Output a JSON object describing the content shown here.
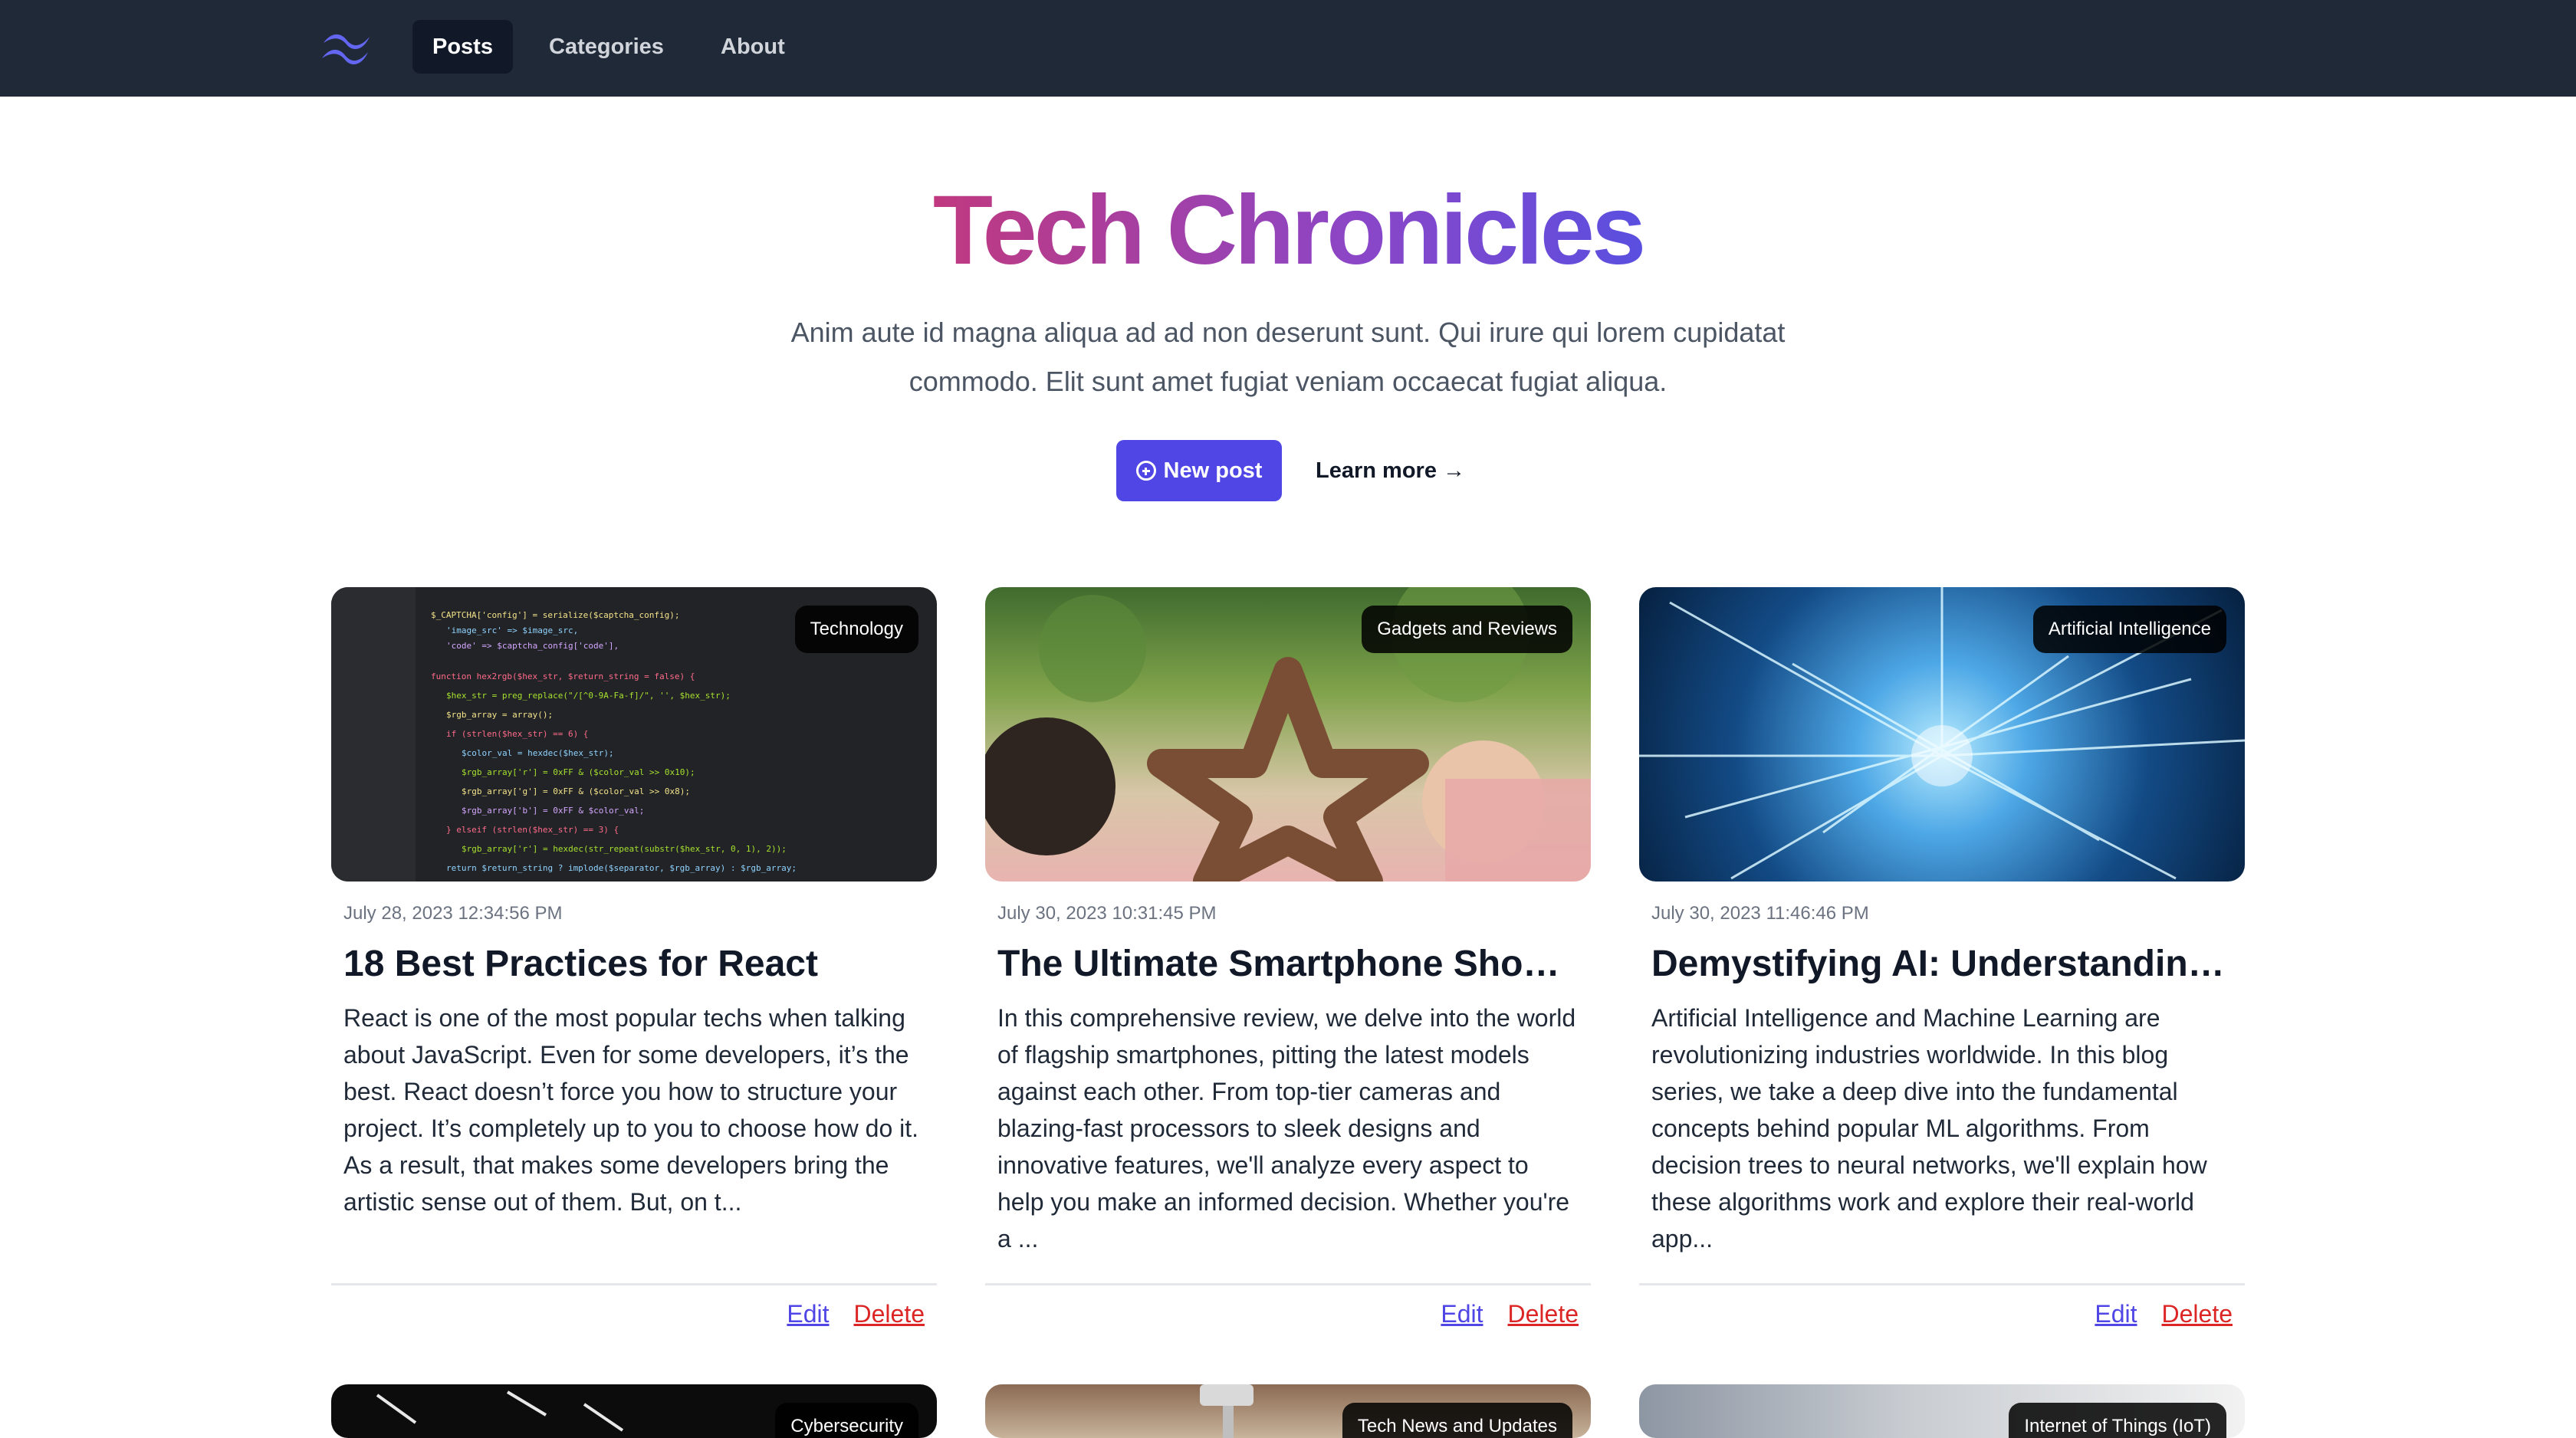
{
  "nav": {
    "logo": "tailwind-logo",
    "links": [
      "Posts",
      "Categories",
      "About"
    ],
    "active": "Posts"
  },
  "hero": {
    "title": "Tech Chronicles",
    "description": "Anim aute id magna aliqua ad ad non deserunt sunt. Qui irure qui lorem cupidatat commodo. Elit sunt amet fugiat veniam occaecat fugiat aliqua.",
    "new_post_label": "New post",
    "learn_more_label": "Learn more →"
  },
  "cards": [
    {
      "category": "Technology",
      "date": "July 28, 2023 12:34:56 PM",
      "title": "18 Best Practices for React",
      "excerpt": "React is one of the most popular techs when talking about JavaScript. Even for some developers, it’s the best. React doesn’t force you how to structure your project. It’s completely up to you to choose how do it. As a result, that makes some developers bring the artistic sense out of them. But, on t...",
      "edit_label": "Edit",
      "delete_label": "Delete"
    },
    {
      "category": "Gadgets and Reviews",
      "date": "July 30, 2023 10:31:45 PM",
      "title": "The Ultimate Smartphone Showd...",
      "excerpt": "In this comprehensive review, we delve into the world of flagship smartphones, pitting the latest models against each other. From top-tier cameras and blazing-fast processors to sleek designs and innovative features, we'll analyze every aspect to help you make an informed decision. Whether you're a ...",
      "edit_label": "Edit",
      "delete_label": "Delete"
    },
    {
      "category": "Artificial Intelligence",
      "date": "July 30, 2023 11:46:46 PM",
      "title": "Demystifying AI: Understanding ...",
      "excerpt": "Artificial Intelligence and Machine Learning are revolutionizing industries worldwide. In this blog series, we take a deep dive into the fundamental concepts behind popular ML algorithms. From decision trees to neural networks, we'll explain how these algorithms work and explore their real-world app...",
      "edit_label": "Edit",
      "delete_label": "Delete"
    },
    {
      "category": "Cybersecurity"
    },
    {
      "category": "Tech News and Updates"
    },
    {
      "category": "Internet of Things (IoT)"
    }
  ]
}
